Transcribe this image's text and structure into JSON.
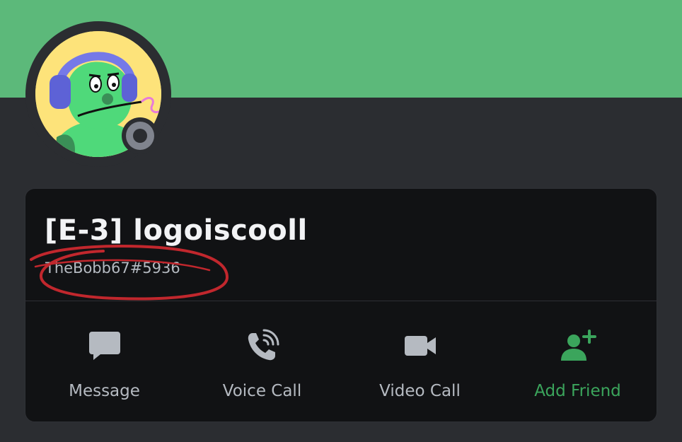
{
  "profile": {
    "display_name": "[E-3] logoiscooll",
    "username": "TheBobb67#5936",
    "status": "offline",
    "banner_color": "#5cb97a"
  },
  "actions": [
    {
      "label": "Message",
      "icon": "message-icon"
    },
    {
      "label": "Voice Call",
      "icon": "phone-icon"
    },
    {
      "label": "Video Call",
      "icon": "video-camera-icon"
    },
    {
      "label": "Add Friend",
      "icon": "add-friend-icon",
      "color": "#3ba55c"
    }
  ],
  "annotation": {
    "color": "#c1272d",
    "shape": "hand-drawn circle around username"
  }
}
